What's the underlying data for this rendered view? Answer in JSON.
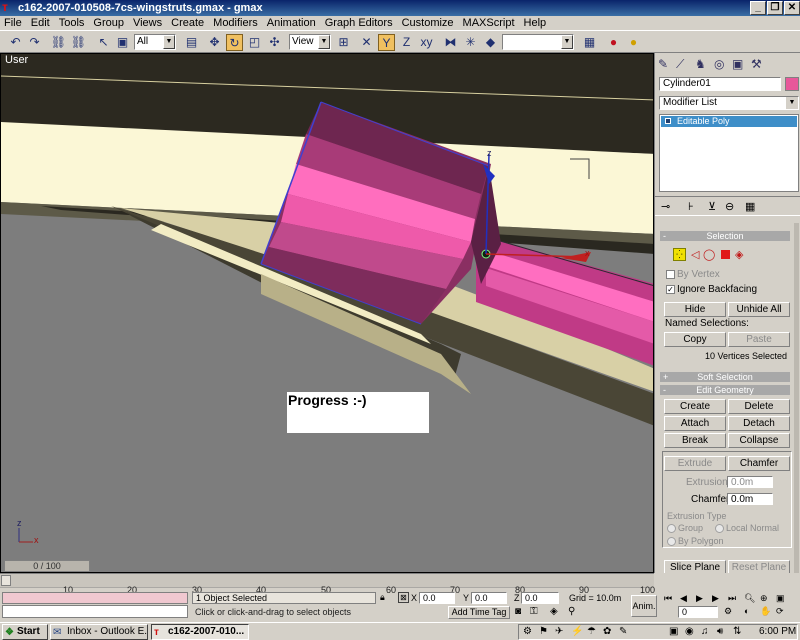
{
  "window": {
    "title": "c162-2007-010508-7cs-wingstruts.gmax - gmax",
    "controls": [
      "_",
      "❐",
      "✕"
    ]
  },
  "menu": [
    "File",
    "Edit",
    "Tools",
    "Group",
    "Views",
    "Create",
    "Modifiers",
    "Animation",
    "Graph Editors",
    "Customize",
    "MAXScript",
    "Help"
  ],
  "toolbar": {
    "selection_filter": "All",
    "ref_coord": "View",
    "named_sel": ""
  },
  "viewport": {
    "label": "User",
    "overlay_text": "Progress :-)",
    "frame_counter": "0 / 100",
    "axis_x": "x",
    "axis_z": "z",
    "gizmo_x": "x",
    "gizmo_z": "z",
    "mini_axis_x": "x",
    "mini_axis_z": "z"
  },
  "panel": {
    "object_name": "Cylinder01",
    "object_color": "#e8589a",
    "modifier_list": "Modifier List",
    "stack_item": "Editable Poly",
    "selection": {
      "header": "Selection",
      "by_vertex": "By Vertex",
      "ignore_backfacing": "Ignore Backfacing",
      "hide": "Hide",
      "unhide_all": "Unhide All",
      "named_selections": "Named Selections:",
      "copy": "Copy",
      "paste": "Paste",
      "status": "10 Vertices Selected"
    },
    "soft_selection": "Soft Selection",
    "edit_geometry": {
      "header": "Edit Geometry",
      "create": "Create",
      "delete": "Delete",
      "attach": "Attach",
      "detach": "Detach",
      "break": "Break",
      "collapse": "Collapse",
      "extrude": "Extrude",
      "chamfer": "Chamfer",
      "extrusion_label": "Extrusion",
      "extrusion_value": "0.0m",
      "chamfer_label": "Chamfer",
      "chamfer_value": "0.0m",
      "extrusion_type": "Extrusion Type",
      "group": "Group",
      "local_normal": "Local Normal",
      "by_polygon": "By Polygon",
      "slice_plane": "Slice Plane",
      "reset_plane": "Reset Plane"
    }
  },
  "timeline": {
    "ticks": [
      "10",
      "20",
      "30",
      "40",
      "50",
      "60",
      "70",
      "80",
      "90",
      "100"
    ]
  },
  "status": {
    "selected": "1 Object Selected",
    "prompt": "Click or click-and-drag to select objects",
    "x_label": "X",
    "x_value": "0.0",
    "y_label": "Y",
    "y_value": "0.0",
    "z_label": "Z",
    "z_value": "0.0",
    "grid": "Grid = 10.0m",
    "add_time_tag": "Add Time Tag",
    "anim": "Anim.",
    "frame": "0"
  },
  "taskbar": {
    "start": "Start",
    "task1": "Inbox - Outlook E...",
    "task2": "c162-2007-010...",
    "clock": "6:00 PM"
  }
}
